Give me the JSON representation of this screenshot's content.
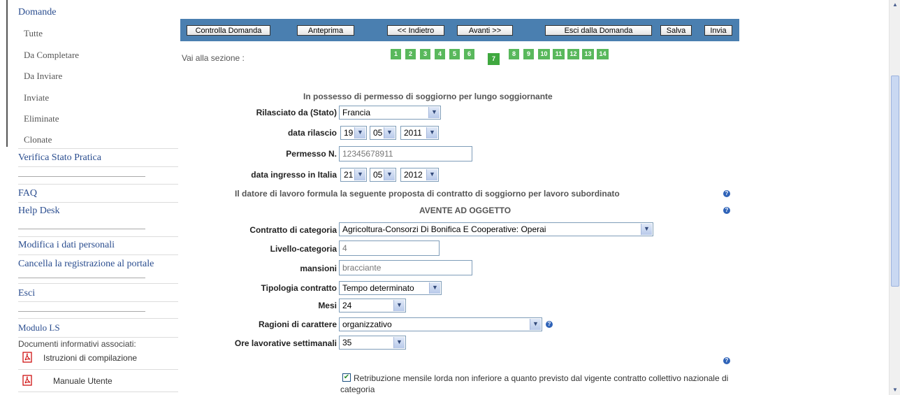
{
  "sidebar": {
    "domande": "Domande",
    "sub": [
      "Tutte",
      "Da Completare",
      "Da Inviare",
      "Inviate",
      "Eliminate",
      "Clonate"
    ],
    "verifica": "Verifica Stato Pratica",
    "faq": "FAQ",
    "helpdesk": "Help Desk",
    "modifica": "Modifica i dati personali",
    "cancella": "Cancella la registrazione al portale",
    "esci": "Esci",
    "modulo": "Modulo LS",
    "documenti": "Documenti informativi associati:",
    "docs": [
      "Istruzioni di compilazione",
      "Manuale Utente"
    ]
  },
  "toolbar": {
    "controlla": "Controlla Domanda",
    "anteprima": "Anteprima",
    "indietro": "<< Indietro",
    "avanti": "Avanti >>",
    "esci": "Esci dalla Domanda",
    "salva": "Salva",
    "invia": "Invia"
  },
  "sections": {
    "label": "Vai alla sezione :",
    "numbers": [
      "1",
      "2",
      "3",
      "4",
      "5",
      "6",
      "7",
      "8",
      "9",
      "10",
      "11",
      "12",
      "13",
      "14"
    ],
    "active": "7"
  },
  "form": {
    "title1": "In possesso di permesso di soggiorno per lungo soggiornante",
    "rilasciato_label": "Rilasciato da (Stato)",
    "rilasciato_value": "Francia",
    "data_rilascio_label": "data rilascio",
    "data_rilascio": {
      "day": "19",
      "month": "05",
      "year": "2011"
    },
    "permesso_label": "Permesso N.",
    "permesso_value": "12345678911",
    "ingresso_label": "data ingresso in Italia",
    "ingresso": {
      "day": "21",
      "month": "05",
      "year": "2012"
    },
    "title2": "Il datore di lavoro formula la seguente proposta di contratto di soggiorno per lavoro subordinato",
    "title3": "AVENTE AD OGGETTO",
    "contratto_label": "Contratto di categoria",
    "contratto_value": "Agricoltura-Consorzi Di Bonifica E Cooperative: Operai",
    "livello_label": "Livello-categoria",
    "livello_value": "4",
    "mansioni_label": "mansioni",
    "mansioni_value": "bracciante",
    "tipologia_label": "Tipologia contratto",
    "tipologia_value": "Tempo determinato",
    "mesi_label": "Mesi",
    "mesi_value": "24",
    "ragioni_label": "Ragioni di carattere",
    "ragioni_value": "organizzativo",
    "ore_label": "Ore lavorative settimanali",
    "ore_value": "35",
    "retribuzione_line1": "Retribuzione mensile lorda non inferiore a quanto previsto dal vigente contratto collettivo nazionale di",
    "retribuzione_line2": "categoria"
  },
  "icons": {
    "help": "?",
    "dropdown": "▼",
    "check": "✔"
  },
  "colors": {
    "toolbar": "#4a7fb0",
    "section": "#59b85c",
    "link": "#2a4d8f",
    "help": "#2f63b8"
  }
}
